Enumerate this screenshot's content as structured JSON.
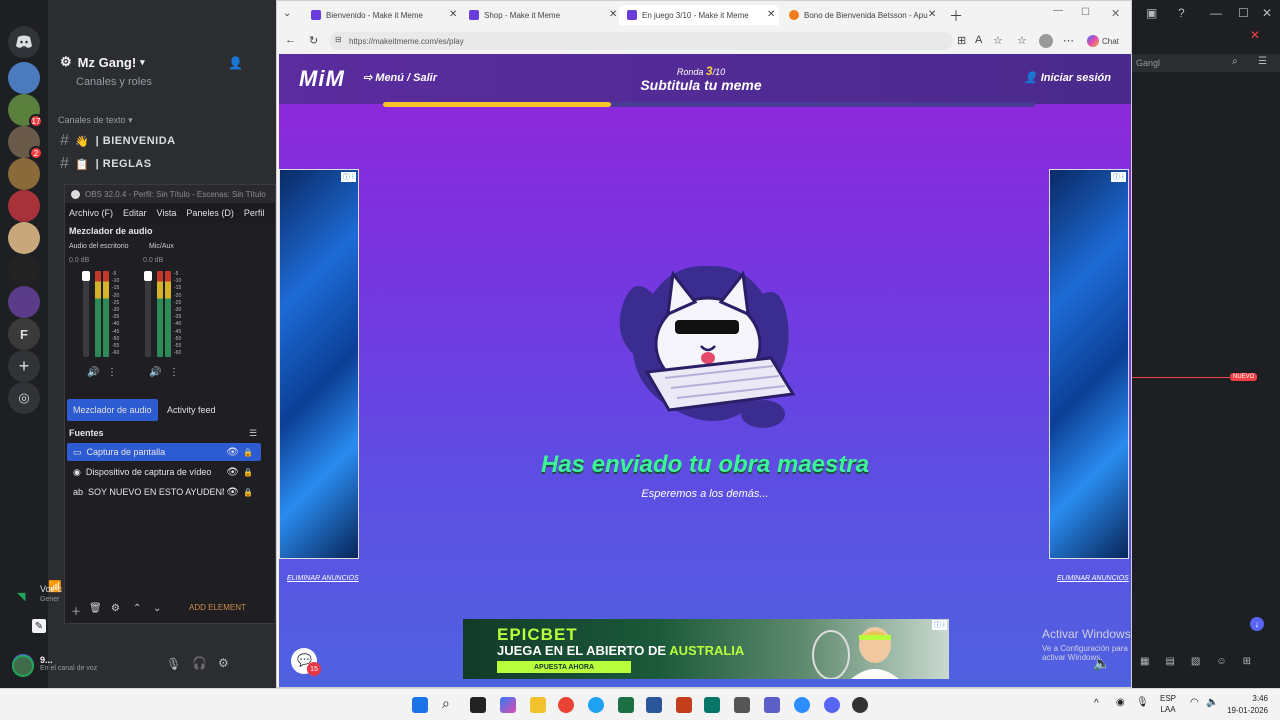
{
  "discord": {
    "server_name": "Mz Gang!",
    "channels_roles": "Canales y roles",
    "text_channels_header": "Canales de texto",
    "channels": [
      {
        "label": "BIENVENIDA",
        "emoji": "👋"
      },
      {
        "label": "REGLAS",
        "emoji": "📋"
      }
    ],
    "server_badges": [
      "17",
      "2"
    ],
    "voice_status": "Voz c",
    "voice_sub": "Gener",
    "user_name": "9...",
    "user_status": "En el canal de voz",
    "right_search_text": "Gangl",
    "new_badge": "NUEVO"
  },
  "obs": {
    "title": "OBS 32.0.4 - Perfil: Sin Título - Escenas: Sin Título",
    "menu": [
      "Archivo (F)",
      "Editar",
      "Vista",
      "Paneles (D)",
      "Perfil"
    ],
    "mixer_title": "Mezclador de audio",
    "channels": [
      {
        "name": "Audio del escritorio",
        "db": "0.0 dB"
      },
      {
        "name": "Mic/Aux",
        "db": "0.0 dB"
      }
    ],
    "meter_scale": [
      "-5",
      "-10",
      "-15",
      "-20",
      "-25",
      "-30",
      "-35",
      "-40",
      "-45",
      "-50",
      "-55",
      "-60"
    ],
    "tabs": [
      "Mezclador de audio",
      "Activity feed"
    ],
    "sources_title": "Fuentes",
    "sources": [
      {
        "label": "Captura de pantalla",
        "icon": "monitor-icon",
        "selected": true
      },
      {
        "label": "Dispositivo de captura de vídeo",
        "icon": "camera-icon",
        "selected": false
      },
      {
        "label": "SOY NUEVO EN ESTO AYUDENME A",
        "icon": "text-icon",
        "selected": false
      }
    ],
    "add_element": "ADD ELEMENT"
  },
  "browser": {
    "tabs": [
      {
        "title": "Bienvenido - Make it Meme",
        "active": false
      },
      {
        "title": "Shop - Make it Meme",
        "active": false
      },
      {
        "title": "En juego 3/10 - Make it Meme",
        "active": true
      },
      {
        "title": "Bono de Bienvenida Betsson - Apu",
        "active": false
      }
    ],
    "url": "https://makeitmeme.com/es/play",
    "copilot_label": "Chat"
  },
  "game": {
    "logo": "MiM",
    "menu_label": "Menú / Salir",
    "round_prefix": "Ronda",
    "round_current": "3",
    "round_total": "/10",
    "round_title": "Subtitula tu meme",
    "login_label": "Iniciar sesión",
    "timer_progress": 0.35,
    "status_title": "Has enviado tu obra maestra",
    "status_subtitle": "Esperemos a los demás...",
    "remove_ads": "ELIMINAR ANUNCIOS",
    "chat_badge": "15",
    "accent_color": "#3cf59b"
  },
  "ad_banner": {
    "brand": "EPICBET",
    "headline_pre": "JUEGA EN EL ABIERTO DE",
    "headline_highlight": "AUSTRALIA",
    "cta": "APUESTA AHORA"
  },
  "windows": {
    "activate_title": "Activar Windows",
    "activate_sub": "Ve a Configuración para activar Windows.",
    "lang_top": "ESP",
    "lang_bottom": "LAA",
    "time": "3:46",
    "date": "19-01-2026"
  }
}
